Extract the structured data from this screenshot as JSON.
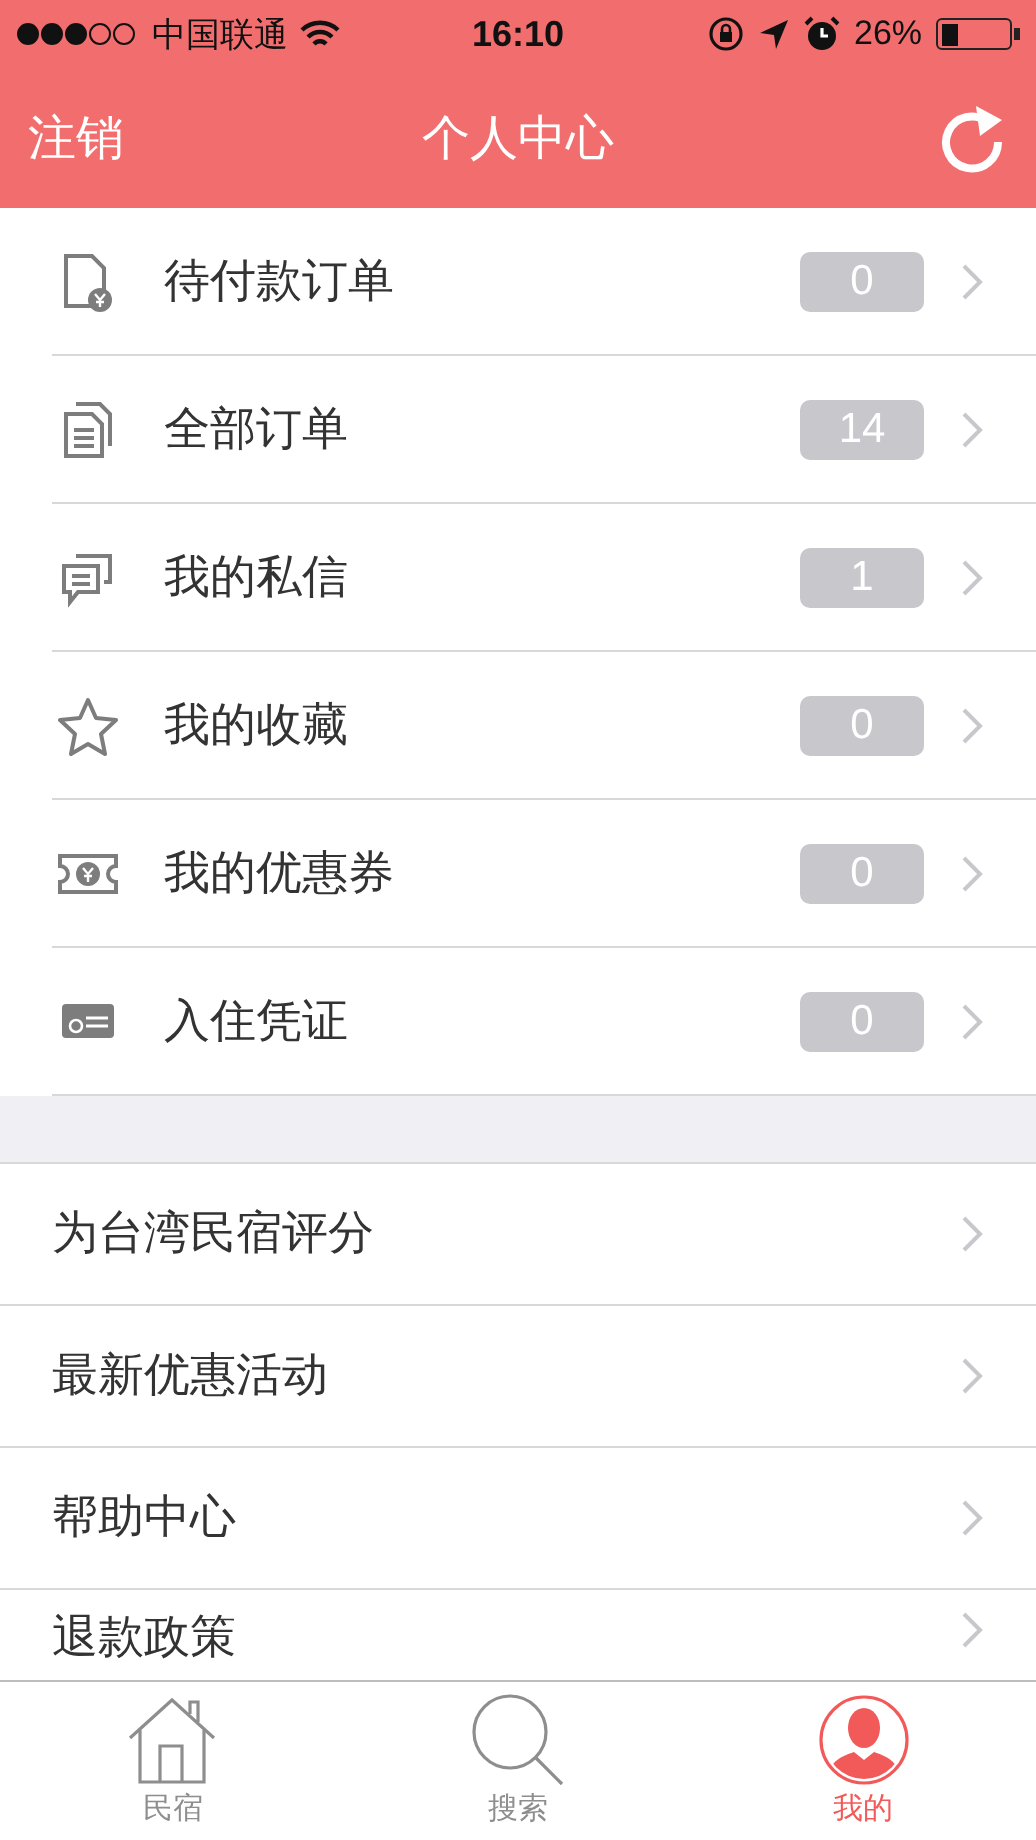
{
  "status_bar": {
    "carrier": "中国联通",
    "time": "16:10",
    "battery": "26%"
  },
  "nav_bar": {
    "left_button": "注销",
    "title": "个人中心"
  },
  "order_items": [
    {
      "label": "待付款订单",
      "count": "0"
    },
    {
      "label": "全部订单",
      "count": "14"
    },
    {
      "label": "我的私信",
      "count": "1"
    },
    {
      "label": "我的收藏",
      "count": "0"
    },
    {
      "label": "我的优惠券",
      "count": "0"
    },
    {
      "label": "入住凭证",
      "count": "0"
    }
  ],
  "link_items": [
    {
      "label": "为台湾民宿评分"
    },
    {
      "label": "最新优惠活动"
    },
    {
      "label": "帮助中心"
    },
    {
      "label": "退款政策"
    }
  ],
  "tab_bar": [
    {
      "label": "民宿",
      "selected": false
    },
    {
      "label": "搜索",
      "selected": false
    },
    {
      "label": "我的",
      "selected": true
    }
  ]
}
